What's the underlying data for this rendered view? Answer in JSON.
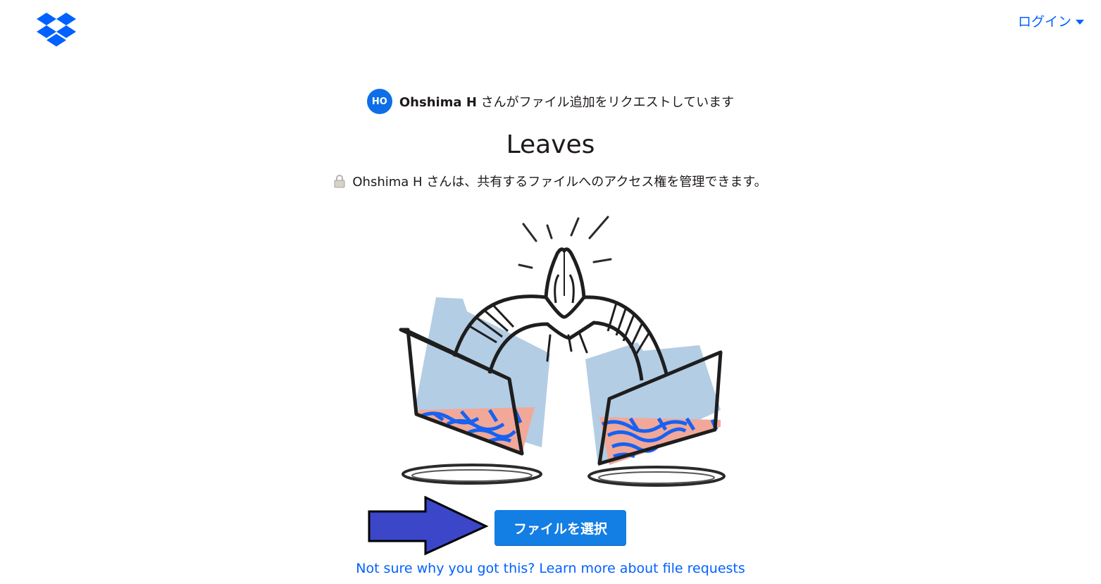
{
  "header": {
    "logo_icon": "dropbox-logo-icon",
    "login_label": "ログイン",
    "brand_color": "#0061fe"
  },
  "request": {
    "avatar_initials": "HO",
    "requester_name": "Ohshima H",
    "request_text": "さんがファイル追加をリクエストしています",
    "title": "Leaves",
    "access_note": "Ohshima H さんは、共有するファイルへのアクセス権を管理できます。",
    "lock_icon": "lock-icon"
  },
  "actions": {
    "choose_file_label": "ファイルを選択",
    "learn_more_link": "Not sure why you got this? Learn more about file requests",
    "button_color": "#137ee3",
    "arrow_color": "#3b46c8"
  }
}
